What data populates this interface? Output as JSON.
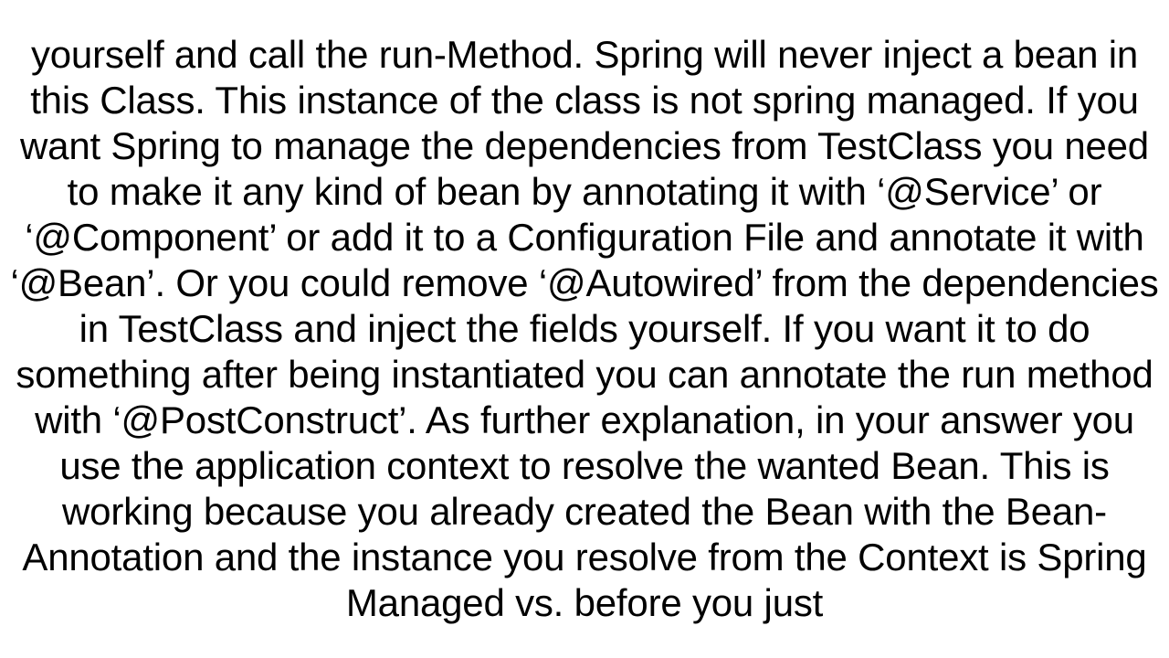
{
  "body_text": "yourself and call the run-Method. Spring will never inject a bean in this Class. This instance of the class is not spring managed. If you want Spring to manage the dependencies from TestClass you need to make it any kind of bean by annotating it with ‘@Service’ or ‘@Component’ or add it to a Configuration File and annotate it with ‘@Bean’. Or you could remove ‘@Autowired’ from the dependencies in TestClass and inject the fields yourself. If you want it to do something after being instantiated you can annotate the run method with ‘@PostConstruct’. As further explanation, in your answer you use the application context to resolve the wanted Bean. This is working because you already created the Bean with the Bean-Annotation and the instance you resolve from the Context is Spring Managed vs. before you just"
}
